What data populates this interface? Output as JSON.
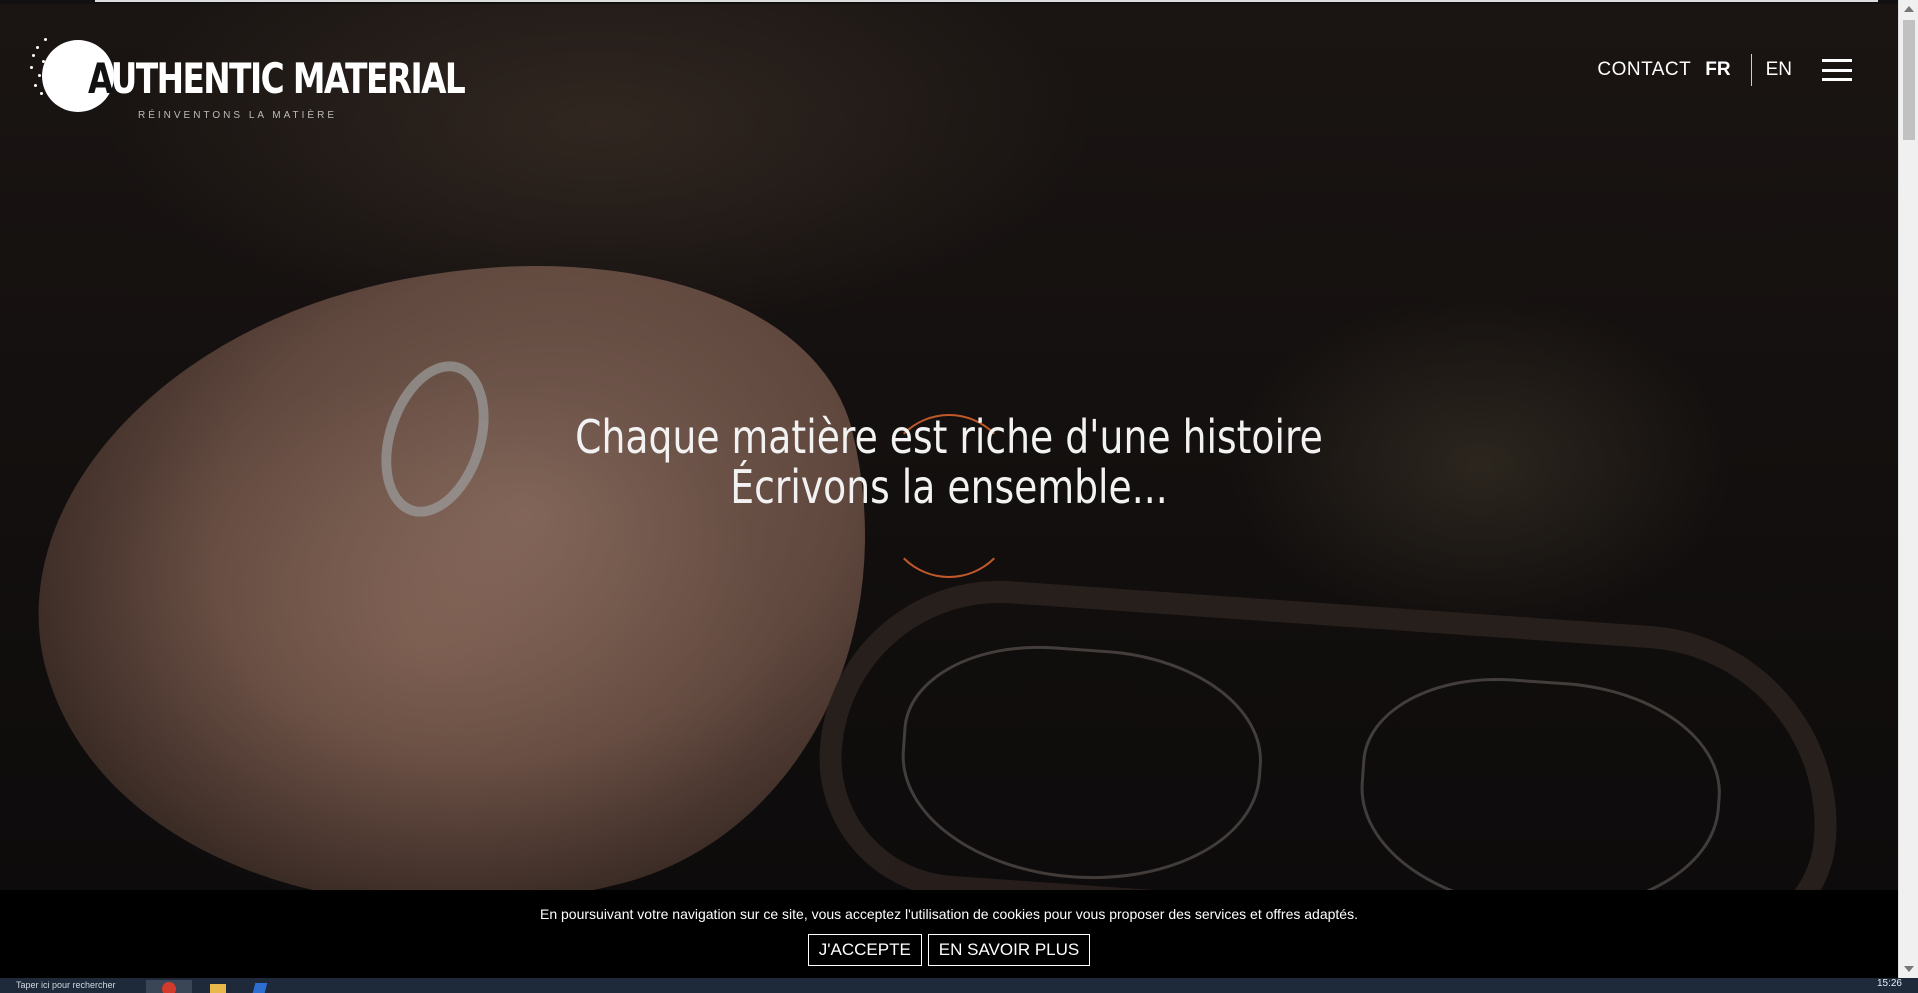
{
  "brand": {
    "name_first_letter": "A",
    "name_rest": "UTHENTIC MATERIAL",
    "tagline": "RÉINVENTONS LA MATIÈRE"
  },
  "nav": {
    "contact": "CONTACT",
    "lang_active": "FR",
    "lang_other": "EN",
    "menu_icon": "hamburger-menu-icon"
  },
  "hero": {
    "headline_line1": "Chaque matière est riche d'une histoire",
    "headline_line2": "Écrivons la ensemble...",
    "accent_color": "#c0592a"
  },
  "cookie_banner": {
    "message": "En poursuivant votre navigation sur ce site, vous acceptez l'utilisation de cookies pour vous proposer des services et offres adaptés.",
    "accept_label": "J'ACCEPTE",
    "more_label": "EN SAVOIR PLUS"
  },
  "taskbar": {
    "search_hint": "Taper ici pour rechercher",
    "clock": "15:26"
  }
}
